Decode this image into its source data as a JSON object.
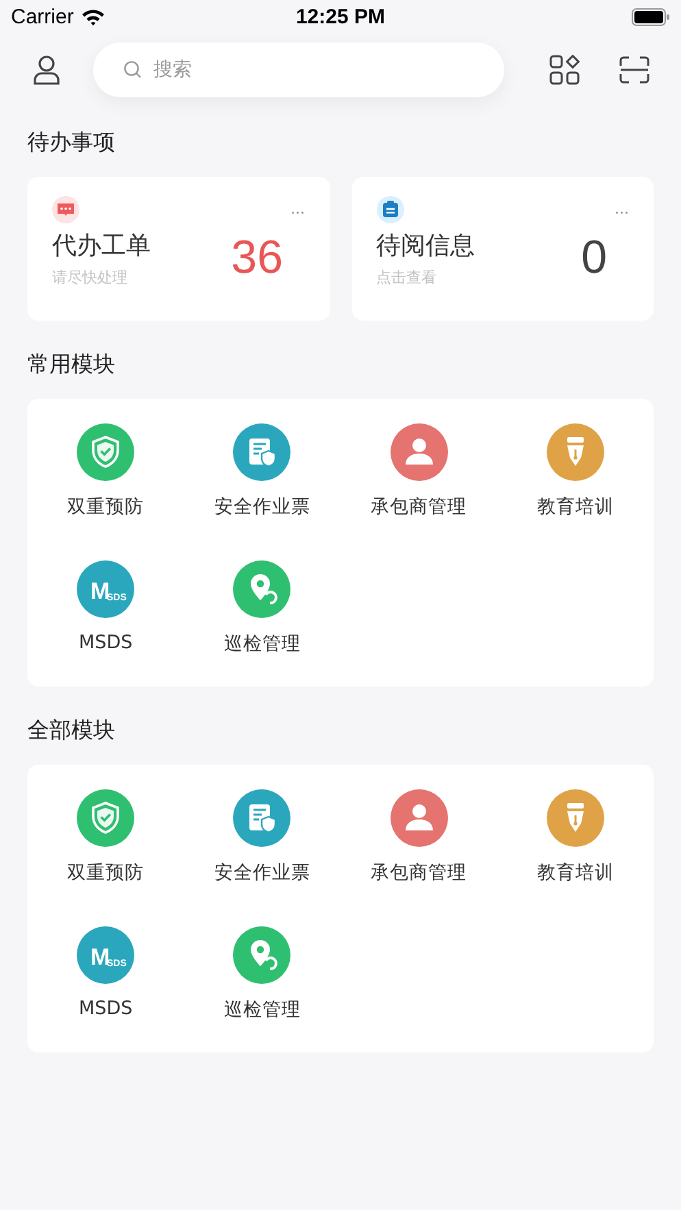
{
  "status_bar": {
    "carrier": "Carrier",
    "time": "12:25 PM"
  },
  "search": {
    "placeholder": "搜索"
  },
  "todo": {
    "title": "待办事项",
    "cards": [
      {
        "kind": "chat",
        "title": "代办工单",
        "subtitle": "请尽快处理",
        "count": "36",
        "more": "···",
        "highlight": true
      },
      {
        "kind": "board",
        "title": "待阅信息",
        "subtitle": "点击查看",
        "count": "0",
        "more": "···",
        "highlight": false
      }
    ]
  },
  "sections": [
    {
      "title": "常用模块",
      "modules": [
        {
          "kind": "shield",
          "color": "#2fbf71",
          "label": "双重预防"
        },
        {
          "kind": "ticket",
          "color": "#2aa7bd",
          "label": "安全作业票"
        },
        {
          "kind": "person",
          "color": "#e5736f",
          "label": "承包商管理"
        },
        {
          "kind": "pen",
          "color": "#dfa247",
          "label": "教育培训"
        },
        {
          "kind": "msds",
          "color": "#2aa7bd",
          "label": "MSDS",
          "icon_text": "M",
          "icon_subtext": "SDS"
        },
        {
          "kind": "pin",
          "color": "#2fbf71",
          "label": "巡检管理"
        }
      ]
    },
    {
      "title": "全部模块",
      "modules": [
        {
          "kind": "shield",
          "color": "#2fbf71",
          "label": "双重预防"
        },
        {
          "kind": "ticket",
          "color": "#2aa7bd",
          "label": "安全作业票"
        },
        {
          "kind": "person",
          "color": "#e5736f",
          "label": "承包商管理"
        },
        {
          "kind": "pen",
          "color": "#dfa247",
          "label": "教育培训"
        },
        {
          "kind": "msds",
          "color": "#2aa7bd",
          "label": "MSDS",
          "icon_text": "M",
          "icon_subtext": "SDS"
        },
        {
          "kind": "pin",
          "color": "#2fbf71",
          "label": "巡检管理"
        }
      ]
    }
  ]
}
